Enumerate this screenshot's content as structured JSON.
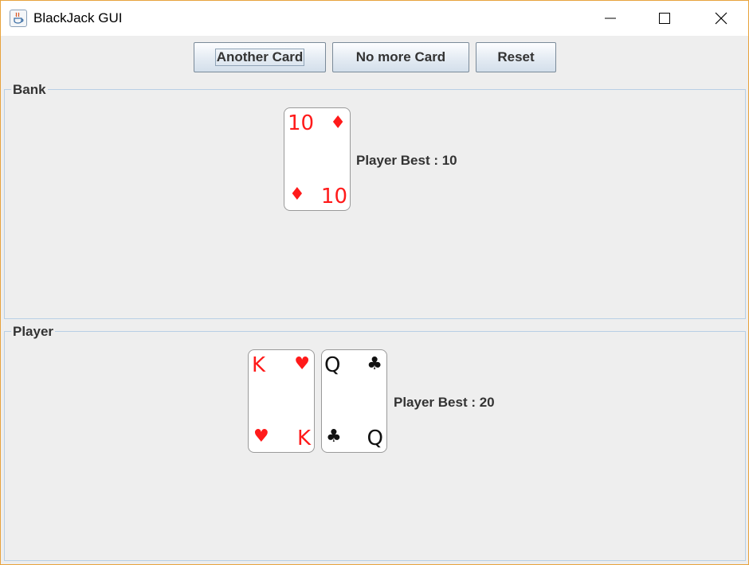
{
  "window": {
    "title": "BlackJack GUI",
    "border_color": "#e8a33d"
  },
  "toolbar": {
    "another_card": "Another Card",
    "no_more_card": "No more Card",
    "reset": "Reset"
  },
  "bank": {
    "title": "Bank",
    "best_text": "Player Best : 10",
    "cards": [
      {
        "rank": "10",
        "suit": "♦",
        "suit_name": "diamonds",
        "color": "#ff1a1a"
      }
    ]
  },
  "player": {
    "title": "Player",
    "best_text": "Player Best : 20",
    "cards": [
      {
        "rank": "K",
        "suit": "♥",
        "suit_name": "hearts",
        "color": "#ff1a1a"
      },
      {
        "rank": "Q",
        "suit": "♣",
        "suit_name": "clubs",
        "color": "#111111"
      }
    ]
  },
  "icons": {
    "app": "java-cup-icon",
    "minimize": "minimize-icon",
    "maximize": "maximize-icon",
    "close": "close-icon"
  }
}
